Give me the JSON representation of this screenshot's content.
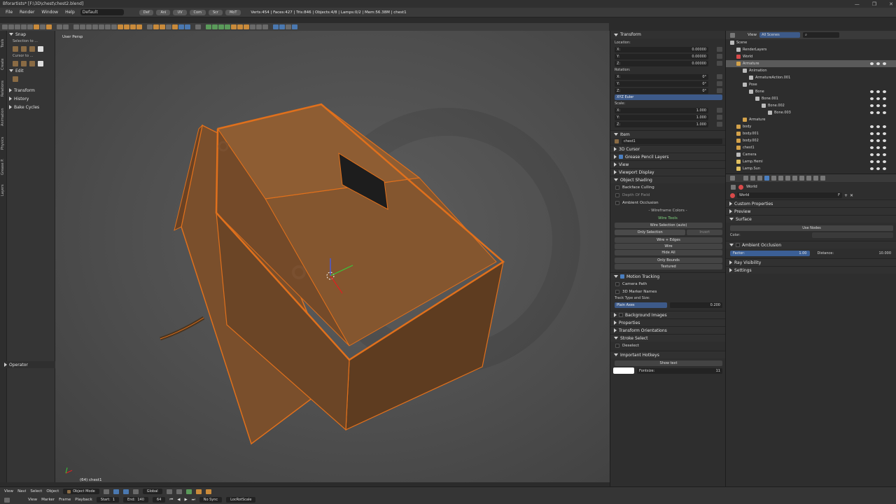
{
  "window": {
    "title": "Bforartists* [F:\\3D\\chest\\chest2.blend]",
    "min": "—",
    "max": "❐",
    "close": "✕"
  },
  "menubar": {
    "items": [
      "File",
      "Render",
      "Window",
      "Help"
    ],
    "layout": "Default",
    "tabs": [
      "Def",
      "Ani",
      "UV",
      "Com",
      "Scr",
      "MoT"
    ],
    "stats": "Verts:454 | Faces:427 | Tris:846 | Objects:4/8 | Lamps:0/2 | Mem:56.38M | chest1"
  },
  "vertical_tabs": [
    "Tools",
    "Create",
    "Relations",
    "Animation",
    "Physics",
    "Grease P.",
    "Layers"
  ],
  "toolshelf": {
    "snap": "Snap",
    "selection_to": "Selection to ...",
    "cursor_to": "Cursor to ...",
    "edit": "Edit",
    "transform": "Transform",
    "history": "History",
    "bake_cycles": "Bake Cycles",
    "operator": "Operator"
  },
  "viewport": {
    "view_name": "User Persp",
    "object_label": "(64) chest1"
  },
  "npanel": {
    "transform": "Transform",
    "location": "Location:",
    "loc": [
      {
        "axis": "X:",
        "val": "0.00000"
      },
      {
        "axis": "Y:",
        "val": "0.00000"
      },
      {
        "axis": "Z:",
        "val": "0.00000"
      }
    ],
    "rotation": "Rotation:",
    "rot": [
      {
        "axis": "X:",
        "val": "0°"
      },
      {
        "axis": "Y:",
        "val": "0°"
      },
      {
        "axis": "Z:",
        "val": "0°"
      }
    ],
    "rotation_mode": "XYZ Euler",
    "scale": "Scale:",
    "scl": [
      {
        "axis": "X:",
        "val": "1.000"
      },
      {
        "axis": "Y:",
        "val": "1.000"
      },
      {
        "axis": "Z:",
        "val": "1.000"
      }
    ],
    "item": "Item",
    "item_name": "chest1",
    "cursor_3d": "3D Cursor",
    "grease_pencil_layers": "Grease Pencil Layers",
    "view": "View",
    "viewport_display": "Viewport Display",
    "object_shading": "Object Shading",
    "backface_culling": "Backface Culling",
    "depth_of_field": "Depth Of Field",
    "ambient_occlusion": "Ambient Occlusion",
    "wireframe_colors": "- Wireframe Colors -",
    "wire_tools": "Wire Tools",
    "wire_selection": "Wire Selection (auto)",
    "only_selection": "Only Selection",
    "invert": "Invert",
    "wire_edges": "Wire + Edges",
    "wire": "Wire",
    "hide_all": "Hide All",
    "only_bounds": "Only Bounds",
    "textured": "Textured",
    "motion_tracking": "Motion Tracking",
    "camera_path": "Camera Path",
    "marker_names": "3D Marker Names",
    "track_type": "Track Type and Size:",
    "plain_axes": "Plain Axes",
    "track_size": "0.200",
    "background_images": "Background Images",
    "properties": "Properties",
    "transform_orientations": "Transform Orientations",
    "stroke_select": "Stroke Select",
    "deselect": "Deselect",
    "important_hotkeys": "Important Hotkeys",
    "show_text": "Show text",
    "fontsize_label": "Fontsize:",
    "fontsize": "11"
  },
  "outliner": {
    "view": "View",
    "scenes": "All Scenes",
    "rows": [
      {
        "label": "Scene",
        "indent": 0,
        "color": "#bbbbbb",
        "hl": false,
        "eyes": false
      },
      {
        "label": "RenderLayers",
        "indent": 1,
        "color": "#bbbbbb",
        "hl": false,
        "eyes": false
      },
      {
        "label": "World",
        "indent": 1,
        "color": "#d94a4a",
        "hl": false,
        "eyes": false
      },
      {
        "label": "Armature",
        "indent": 1,
        "color": "#d4a24a",
        "hl": true,
        "eyes": true
      },
      {
        "label": "Animation",
        "indent": 2,
        "color": "#bbbbbb",
        "hl": false,
        "eyes": false
      },
      {
        "label": "ArmatureAction.001",
        "indent": 3,
        "color": "#bbbbbb",
        "hl": false,
        "eyes": false
      },
      {
        "label": "Pose",
        "indent": 2,
        "color": "#bbbbbb",
        "hl": false,
        "eyes": false
      },
      {
        "label": "Bone",
        "indent": 3,
        "color": "#bbbbbb",
        "hl": false,
        "eyes": true
      },
      {
        "label": "Bone.001",
        "indent": 4,
        "color": "#bbbbbb",
        "hl": false,
        "eyes": true
      },
      {
        "label": "Bone.002",
        "indent": 5,
        "color": "#bbbbbb",
        "hl": false,
        "eyes": true
      },
      {
        "label": "Bone.003",
        "indent": 6,
        "color": "#bbbbbb",
        "hl": false,
        "eyes": true
      },
      {
        "label": "Armature",
        "indent": 2,
        "color": "#d4a24a",
        "hl": false,
        "eyes": false
      },
      {
        "label": "body",
        "indent": 1,
        "color": "#d4a24a",
        "hl": false,
        "eyes": true
      },
      {
        "label": "body.001",
        "indent": 1,
        "color": "#d4a24a",
        "hl": false,
        "eyes": true
      },
      {
        "label": "body.002",
        "indent": 1,
        "color": "#d4a24a",
        "hl": false,
        "eyes": true
      },
      {
        "label": "chest1",
        "indent": 1,
        "color": "#d4a24a",
        "hl": false,
        "eyes": true
      },
      {
        "label": "Camera",
        "indent": 1,
        "color": "#bbbbbb",
        "hl": false,
        "eyes": true
      },
      {
        "label": "Lamp.Hemi",
        "indent": 1,
        "color": "#e0c060",
        "hl": false,
        "eyes": true
      },
      {
        "label": "Lamp.Sun",
        "indent": 1,
        "color": "#e0c060",
        "hl": false,
        "eyes": true
      }
    ]
  },
  "props": {
    "world_crumb": "World",
    "world_name": "World",
    "custom_properties": "Custom Properties",
    "preview": "Preview",
    "surface": "Surface",
    "use_nodes": "Use Nodes",
    "color": "Color:",
    "ambient_occlusion": "Ambient Occlusion",
    "factor_label": "Factor:",
    "factor": "1.00",
    "distance_label": "Distance:",
    "distance": "10.000",
    "ray_visibility": "Ray Visibility",
    "settings": "Settings"
  },
  "bottom": {
    "view": "View",
    "navi": "Navi",
    "select": "Select",
    "object": "Object",
    "mode": "Object Mode",
    "orientation": "Global",
    "tl_view": "View",
    "marker": "Marker",
    "frame": "Frame",
    "playback": "Playback",
    "start_label": "Start:",
    "start": "1",
    "end_label": "End:",
    "end": "140",
    "current": "64",
    "sync": "No Sync",
    "keying": "LocRotScale"
  }
}
